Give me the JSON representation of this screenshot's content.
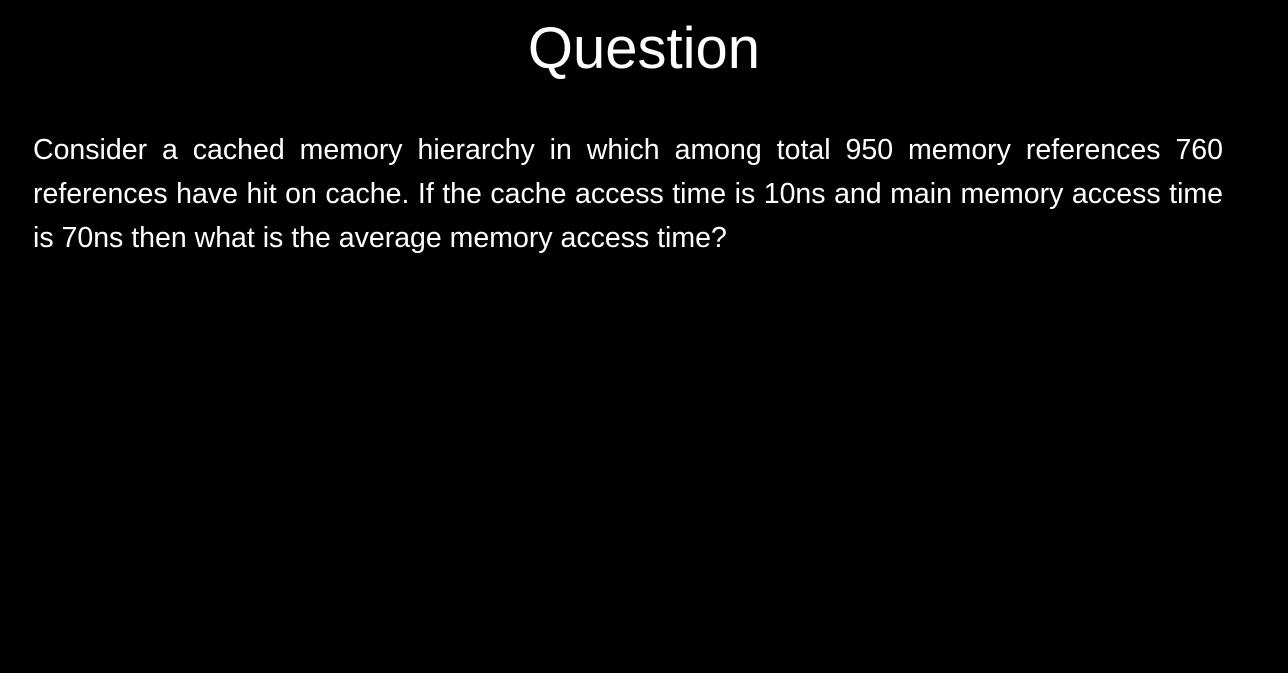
{
  "slide": {
    "title": "Question",
    "question_text": "Consider a cached memory hierarchy in which among total 950 memory references 760 references have hit on cache. If the cache access time is 10ns and main memory access time is 70ns then what is the average memory access time?"
  },
  "colors": {
    "background": "#000000",
    "text": "#ffffff"
  }
}
